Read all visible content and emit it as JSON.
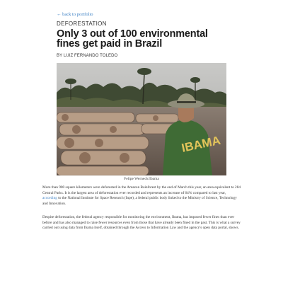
{
  "nav": {
    "back_label": "← back to portfolio"
  },
  "article": {
    "category": "DEFORESTATION",
    "title": "Only 3 out of 100 environmental fines get paid in Brazil",
    "byline": "BY LUIZ FERNANDO TOLEDO",
    "photo_caption": "Felipe Werneck/Ibama",
    "photo_vest_text": "IBAMA",
    "paragraph1": {
      "before_link": "More than 900 square kilometers were deforested in the Amazon Rainforest by the end of March this year, an area equivalent to 284 Central Parks. It is the largest area of deforestation ever recorded and represents an increase of 64% compared to last year,",
      "link": "according",
      "after_link": "to the National Institute for Space Research (Inpe), a federal public body linked to the Ministry of Science, Technology and Innovation."
    },
    "paragraph2": "Despite deforestation, the federal agency responsible for monitoring the environment, Ibama, has imposed fewer fines than ever before and has also managed to raise fewer resources even from those that have already been fined in the past. This is what a survey carried out using data from Ibama itself, obtained through the Access to Information Law and the agency's open data portal, shows."
  },
  "colors": {
    "link": "#3a7fc4",
    "vest": "#3f6b35",
    "vest_text": "#e3c45a"
  }
}
